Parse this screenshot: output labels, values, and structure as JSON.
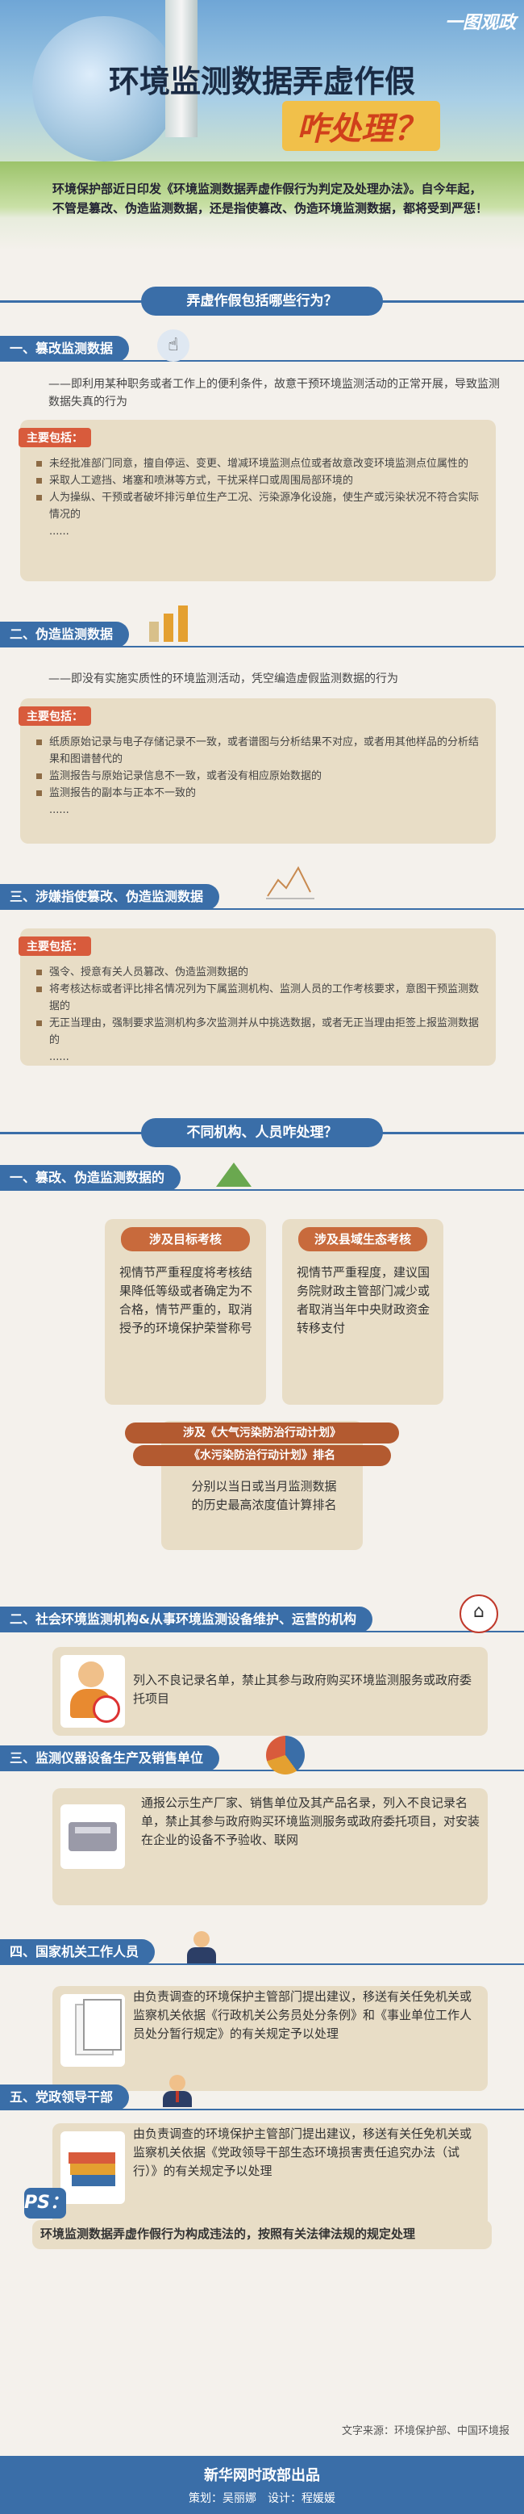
{
  "header": {
    "tag": "一图观政",
    "title_line1": "环境监测数据弄虚作假",
    "title_line2": "咋处理？",
    "intro": "环境保护部近日印发《环境监测数据弄虚作假行为判定及处理办法》。自今年起，不管是篡改、伪造监测数据，还是指使篡改、伪造环境监测数据，都将受到严惩！"
  },
  "banner1": "弄虚作假包括哪些行为？",
  "s1": {
    "title": "一、篡改监测数据",
    "desc": "——即利用某种职务或者工作上的便利条件，故意干预环境监测活动的正常开展，导致监测数据失真的行为",
    "label": "主要包括：",
    "items": [
      "未经批准部门同意，擅自停运、变更、增减环境监测点位或者故意改变环境监测点位属性的",
      "采取人工遮挡、堵塞和喷淋等方式，干扰采样口或周围局部环境的",
      "人为操纵、干预或者破坏排污单位生产工况、污染源净化设施，使生产或污染状况不符合实际情况的",
      "......"
    ]
  },
  "s2": {
    "title": "二、伪造监测数据",
    "desc": "——即没有实施实质性的环境监测活动，凭空编造虚假监测数据的行为",
    "label": "主要包括：",
    "items": [
      "纸质原始记录与电子存储记录不一致，或者谱图与分析结果不对应，或者用其他样品的分析结果和图谱替代的",
      "监测报告与原始记录信息不一致，或者没有相应原始数据的",
      "监测报告的副本与正本不一致的",
      "......"
    ]
  },
  "s3": {
    "title": "三、涉嫌指使篡改、伪造监测数据",
    "label": "主要包括：",
    "items": [
      "强令、授意有关人员篡改、伪造监测数据的",
      "将考核达标或者评比排名情况列为下属监测机构、监测人员的工作考核要求，意图干预监测数据的",
      "无正当理由，强制要求监测机构多次监测并从中挑选数据，或者无正当理由拒签上报监测数据的",
      "......"
    ]
  },
  "banner2": "不同机构、人员咋处理？",
  "p1": {
    "title": "一、篡改、伪造监测数据的",
    "left_tab": "涉及目标考核",
    "left_text": "视情节严重程度将考核结果降低等级或者确定为不合格，情节严重的，取消授予的环境保护荣誉称号",
    "right_tab": "涉及县域生态考核",
    "right_text": "视情节严重程度，建议国务院财政主管部门减少或者取消当年中央财政资金转移支付",
    "center_tab_1": "涉及《大气污染防治行动计划》",
    "center_tab_2": "《水污染防治行动计划》排名",
    "center_text": "分别以当日或当月监测数据的历史最高浓度值计算排名"
  },
  "p2": {
    "title": "二、社会环境监测机构&从事环境监测设备维护、运营的机构",
    "text": "列入不良记录名单，禁止其参与政府购买环境监测服务或政府委托项目"
  },
  "p3": {
    "title": "三、监测仪器设备生产及销售单位",
    "text": "通报公示生产厂家、销售单位及其产品名录，列入不良记录名单，禁止其参与政府购买环境监测服务或政府委托项目，对安装在企业的设备不予验收、联网"
  },
  "p4": {
    "title": "四、国家机关工作人员",
    "text": "由负责调查的环境保护主管部门提出建议，移送有关任免机关或监察机关依据《行政机关公务员处分条例》和《事业单位工作人员处分暂行规定》的有关规定予以处理"
  },
  "p5": {
    "title": "五、党政领导干部",
    "text": "由负责调查的环境保护主管部门提出建议，移送有关任免机关或监察机关依据《党政领导干部生态环境损害责任追究办法（试行）》的有关规定予以处理"
  },
  "ps": {
    "tag": "PS：",
    "text": "环境监测数据弄虚作假行为构成违法的，按照有关法律法规的规定处理"
  },
  "footer": {
    "source": "文字来源：环境保护部、中国环境报",
    "publisher": "新华网时政部出品",
    "credits": "策划：吴丽娜　设计：程媛媛"
  },
  "colors": {
    "primary": "#3a6ea8",
    "accent": "#d85b3c",
    "tab": "#c86a3c",
    "box": "#e8ddc6"
  }
}
